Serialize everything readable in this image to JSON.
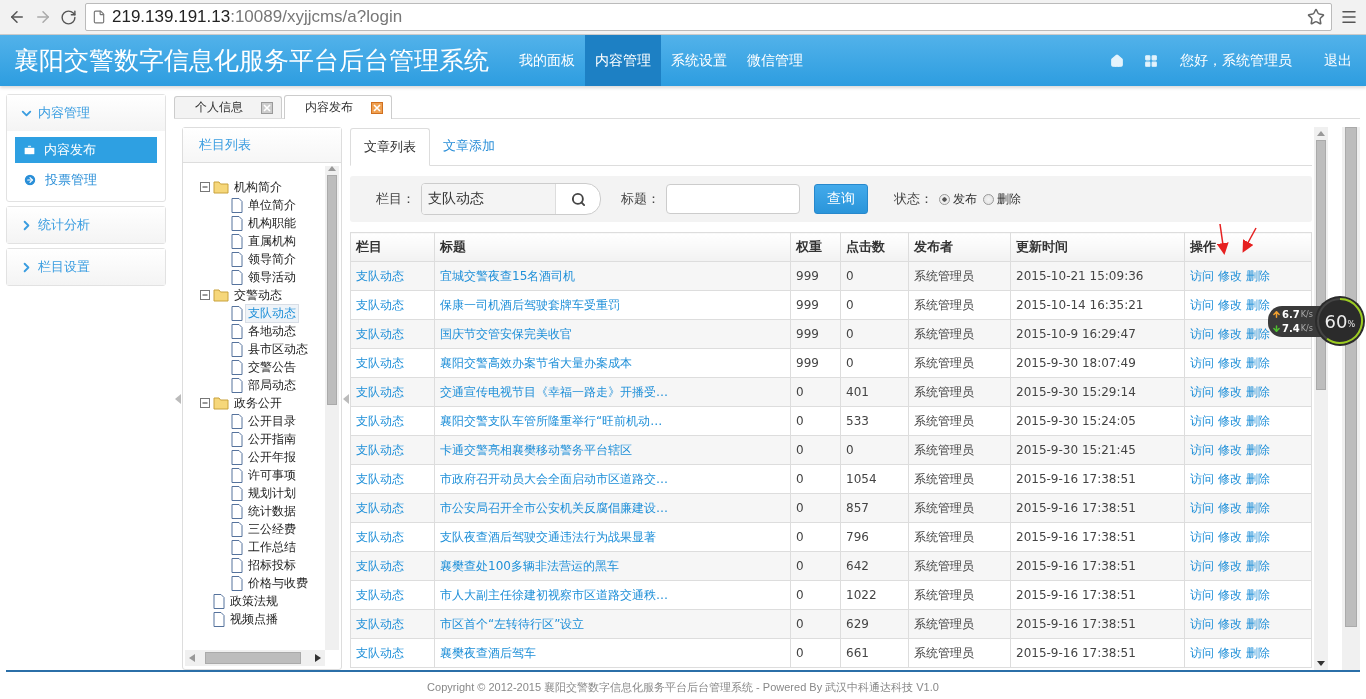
{
  "browser": {
    "url_host": "219.139.191.13",
    "url_path": ":10089/xyjjcms/a?login"
  },
  "header": {
    "title": "襄阳交警数字信息化服务平台后台管理系统",
    "nav": [
      {
        "label": "我的面板",
        "selected": false
      },
      {
        "label": "内容管理",
        "selected": true
      },
      {
        "label": "系统设置",
        "selected": false
      },
      {
        "label": "微信管理",
        "selected": false
      }
    ],
    "greeting": "您好，系统管理员",
    "logout": "退出"
  },
  "sidebar": {
    "sections": [
      {
        "label": "内容管理",
        "expanded": true,
        "items": [
          {
            "label": "内容发布",
            "selected": true,
            "kind": "briefcase"
          },
          {
            "label": "投票管理",
            "selected": false,
            "kind": "arrow"
          }
        ]
      },
      {
        "label": "统计分析",
        "expanded": false
      },
      {
        "label": "栏目设置",
        "expanded": false
      }
    ]
  },
  "tabs": [
    {
      "label": "个人信息",
      "selected": false
    },
    {
      "label": "内容发布",
      "selected": true
    }
  ],
  "tree": {
    "title": "栏目列表",
    "nodes": [
      {
        "label": "机构简介",
        "expanded": true,
        "selected": false,
        "children": [
          {
            "label": "单位简介",
            "selected": false
          },
          {
            "label": "机构职能",
            "selected": false
          },
          {
            "label": "直属机构",
            "selected": false
          },
          {
            "label": "领导简介",
            "selected": false
          },
          {
            "label": "领导活动",
            "selected": false
          }
        ]
      },
      {
        "label": "交警动态",
        "expanded": true,
        "selected": false,
        "children": [
          {
            "label": "支队动态",
            "selected": true
          },
          {
            "label": "各地动态",
            "selected": false
          },
          {
            "label": "县市区动态",
            "selected": false
          },
          {
            "label": "交警公告",
            "selected": false
          },
          {
            "label": "部局动态",
            "selected": false
          }
        ]
      },
      {
        "label": "政务公开",
        "expanded": true,
        "selected": false,
        "children": [
          {
            "label": "公开目录",
            "selected": false
          },
          {
            "label": "公开指南",
            "selected": false
          },
          {
            "label": "公开年报",
            "selected": false
          },
          {
            "label": "许可事项",
            "selected": false
          },
          {
            "label": "规划计划",
            "selected": false
          },
          {
            "label": "统计数据",
            "selected": false
          },
          {
            "label": "三公经费",
            "selected": false
          },
          {
            "label": "工作总结",
            "selected": false
          },
          {
            "label": "招标投标",
            "selected": false
          },
          {
            "label": "价格与收费",
            "selected": false
          }
        ]
      },
      {
        "label": "政策法规",
        "selected": false
      },
      {
        "label": "视频点播",
        "selected": false
      }
    ]
  },
  "content": {
    "tabs": [
      {
        "label": "文章列表",
        "selected": true
      },
      {
        "label": "文章添加",
        "selected": false
      }
    ],
    "filter": {
      "column_label": "栏目：",
      "column_value": "支队动态",
      "title_label": "标题：",
      "search_button": "查询",
      "status_label": "状态：",
      "status_options": [
        {
          "label": "发布",
          "selected": true
        },
        {
          "label": "删除",
          "selected": false
        }
      ]
    },
    "table": {
      "columns": [
        "栏目",
        "标题",
        "权重",
        "点击数",
        "发布者",
        "更新时间",
        "操作"
      ],
      "rows": [
        {
          "column": "支队动态",
          "title": "宜城交警夜查15名酒司机",
          "weight": "999",
          "clicks": "0",
          "publisher": "系统管理员",
          "updated": "2015-10-21 15:09:36",
          "actions": [
            "访问",
            "修改",
            "删除"
          ]
        },
        {
          "column": "支队动态",
          "title": "保康一司机酒后驾驶套牌车受重罚",
          "weight": "999",
          "clicks": "0",
          "publisher": "系统管理员",
          "updated": "2015-10-14 16:35:21",
          "actions": [
            "访问",
            "修改",
            "删除"
          ]
        },
        {
          "column": "支队动态",
          "title": "国庆节交管安保完美收官",
          "weight": "999",
          "clicks": "0",
          "publisher": "系统管理员",
          "updated": "2015-10-9 16:29:47",
          "actions": [
            "访问",
            "修改",
            "删除"
          ]
        },
        {
          "column": "支队动态",
          "title": "襄阳交警高效办案节省大量办案成本",
          "weight": "999",
          "clicks": "0",
          "publisher": "系统管理员",
          "updated": "2015-9-30 18:07:49",
          "actions": [
            "访问",
            "修改",
            "删除"
          ]
        },
        {
          "column": "支队动态",
          "title": "交通宣传电视节目《幸福一路走》开播受…",
          "weight": "0",
          "clicks": "401",
          "publisher": "系统管理员",
          "updated": "2015-9-30 15:29:14",
          "actions": [
            "访问",
            "修改",
            "删除"
          ]
        },
        {
          "column": "支队动态",
          "title": "襄阳交警支队车管所隆重举行“旺前机动…",
          "weight": "0",
          "clicks": "533",
          "publisher": "系统管理员",
          "updated": "2015-9-30 15:24:05",
          "actions": [
            "访问",
            "修改",
            "删除"
          ]
        },
        {
          "column": "支队动态",
          "title": "卡通交警亮相襄樊移动警务平台辖区",
          "weight": "0",
          "clicks": "0",
          "publisher": "系统管理员",
          "updated": "2015-9-30 15:21:45",
          "actions": [
            "访问",
            "修改",
            "删除"
          ]
        },
        {
          "column": "支队动态",
          "title": "市政府召开动员大会全面启动市区道路交…",
          "weight": "0",
          "clicks": "1054",
          "publisher": "系统管理员",
          "updated": "2015-9-16 17:38:51",
          "actions": [
            "访问",
            "修改",
            "删除"
          ]
        },
        {
          "column": "支队动态",
          "title": "市公安局召开全市公安机关反腐倡廉建设…",
          "weight": "0",
          "clicks": "857",
          "publisher": "系统管理员",
          "updated": "2015-9-16 17:38:51",
          "actions": [
            "访问",
            "修改",
            "删除"
          ]
        },
        {
          "column": "支队动态",
          "title": "支队夜查酒后驾驶交通违法行为战果显著",
          "weight": "0",
          "clicks": "796",
          "publisher": "系统管理员",
          "updated": "2015-9-16 17:38:51",
          "actions": [
            "访问",
            "修改",
            "删除"
          ]
        },
        {
          "column": "支队动态",
          "title": "襄樊查处100多辆非法营运的黑车",
          "weight": "0",
          "clicks": "642",
          "publisher": "系统管理员",
          "updated": "2015-9-16 17:38:51",
          "actions": [
            "访问",
            "修改",
            "删除"
          ]
        },
        {
          "column": "支队动态",
          "title": "市人大副主任徐建初视察市区道路交通秩…",
          "weight": "0",
          "clicks": "1022",
          "publisher": "系统管理员",
          "updated": "2015-9-16 17:38:51",
          "actions": [
            "访问",
            "修改",
            "删除"
          ]
        },
        {
          "column": "支队动态",
          "title": "市区首个“左转待行区”设立",
          "weight": "0",
          "clicks": "629",
          "publisher": "系统管理员",
          "updated": "2015-9-16 17:38:51",
          "actions": [
            "访问",
            "修改",
            "删除"
          ]
        },
        {
          "column": "支队动态",
          "title": "襄樊夜查酒后驾车",
          "weight": "0",
          "clicks": "661",
          "publisher": "系统管理员",
          "updated": "2015-9-16 17:38:51",
          "actions": [
            "访问",
            "修改",
            "删除"
          ]
        }
      ]
    }
  },
  "speed_widget": {
    "upload": "6.7",
    "upload_unit": "K/s",
    "download": "7.4",
    "download_unit": "K/s",
    "percent": "60",
    "percent_sign": "%"
  },
  "footer": "Copyright © 2012-2015 襄阳交警数字信息化服务平台后台管理系统 - Powered By 武汉中科通达科技 V1.0"
}
